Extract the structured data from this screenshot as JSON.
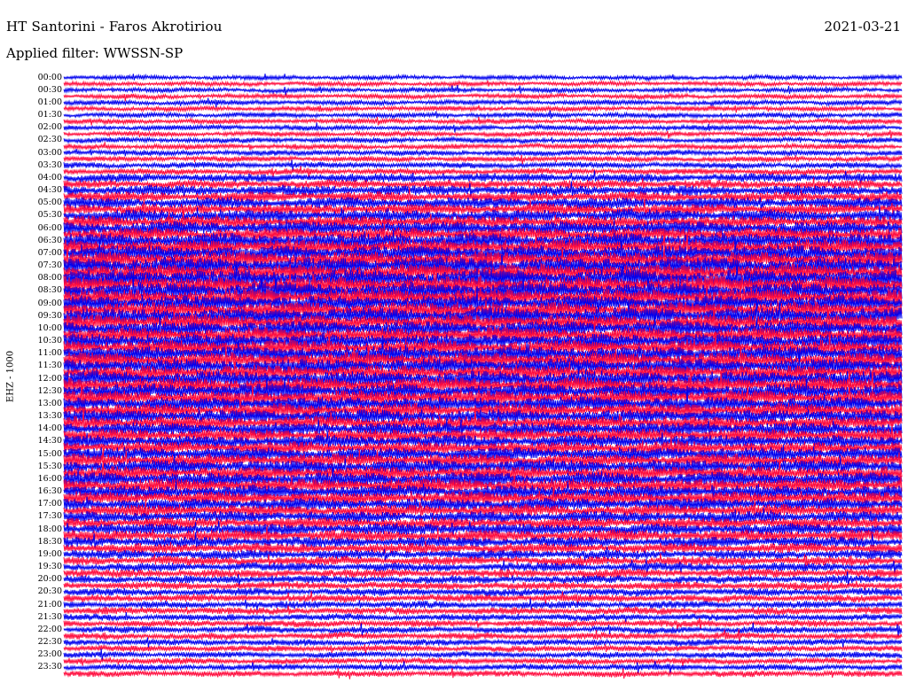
{
  "header": {
    "station": "HT Santorini - Faros Akrotiriou",
    "date": "2021-03-21",
    "filter": "Applied filter: WWSSN-SP"
  },
  "channel": "EHZ - 1000",
  "chart_data": {
    "type": "helicorder",
    "title": "HT Santorini - Faros Akrotiriou",
    "date": "2021-03-21",
    "filter": "WWSSN-SP",
    "channel": "EHZ - 1000",
    "row_interval_minutes": 15,
    "row_count": 96,
    "labeled_rows": [
      "00:00",
      "00:30",
      "01:00",
      "01:30",
      "02:00",
      "02:30",
      "03:00",
      "03:30",
      "04:00",
      "04:30",
      "05:00",
      "05:30",
      "06:00",
      "06:30",
      "07:00",
      "07:30",
      "08:00",
      "08:30",
      "09:00",
      "09:30",
      "10:00",
      "10:30",
      "11:00",
      "11:30",
      "12:00",
      "12:30",
      "13:00",
      "13:30",
      "14:00",
      "14:30",
      "15:00",
      "15:30",
      "16:00",
      "16:30",
      "17:00",
      "17:30",
      "18:00",
      "18:30",
      "19:00",
      "19:30",
      "20:00",
      "20:30",
      "21:00",
      "21:30",
      "22:00",
      "22:30",
      "23:00",
      "23:30"
    ],
    "trace_colors": [
      "#0000ee",
      "#ff0a3c"
    ],
    "relative_amplitude_by_half_hour": [
      0.22,
      0.24,
      0.25,
      0.26,
      0.26,
      0.27,
      0.28,
      0.32,
      0.45,
      0.55,
      0.6,
      0.65,
      0.72,
      0.8,
      0.85,
      0.9,
      0.92,
      0.9,
      0.85,
      0.85,
      0.8,
      0.8,
      0.82,
      0.8,
      0.82,
      0.8,
      0.75,
      0.72,
      0.7,
      0.68,
      0.7,
      0.72,
      0.75,
      0.7,
      0.65,
      0.6,
      0.62,
      0.55,
      0.48,
      0.45,
      0.42,
      0.4,
      0.38,
      0.35,
      0.35,
      0.33,
      0.32,
      0.32
    ]
  }
}
